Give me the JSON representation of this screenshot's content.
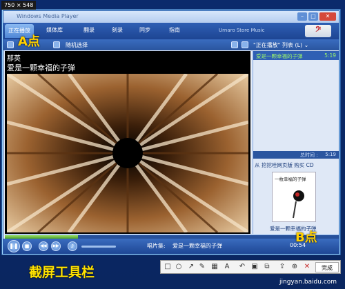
{
  "capture": {
    "dimensions_label": "750 × 548",
    "toolbar_caption": "截屏工具栏",
    "done_label": "完成"
  },
  "annotations": {
    "point_a": "A点",
    "point_b": "B点"
  },
  "player": {
    "title": "Windows Media Player",
    "tabs": [
      "正在播放",
      "媒体库",
      "翻录",
      "刻录",
      "同步",
      "指南"
    ],
    "store": "Urnaro Store Music",
    "shuffle": "随机选择",
    "playlist_header": "\"正在播放\" 列表 (L) ⌄"
  },
  "now_playing": {
    "artist": "那英",
    "song": "爱是一颗幸福的子弹",
    "album_label": "唱片集:",
    "elapsed": "00:54",
    "progress": 0.22
  },
  "playlist": {
    "items": [
      {
        "title": "爱是一颗幸福的子弹",
        "duration": "5:19"
      }
    ],
    "total_label": "总时间 :",
    "total_value": "5:19",
    "source": "从 挖挖哇网页版 购买 CD",
    "caption": "爱是一颗幸福的子弹",
    "art_text": "一枚幸福的子弹"
  },
  "footer": {
    "watermark": "jingyan.baidu.com"
  },
  "colors": {
    "accent": "#ffd000",
    "playlist_text": "#9cf56a"
  }
}
